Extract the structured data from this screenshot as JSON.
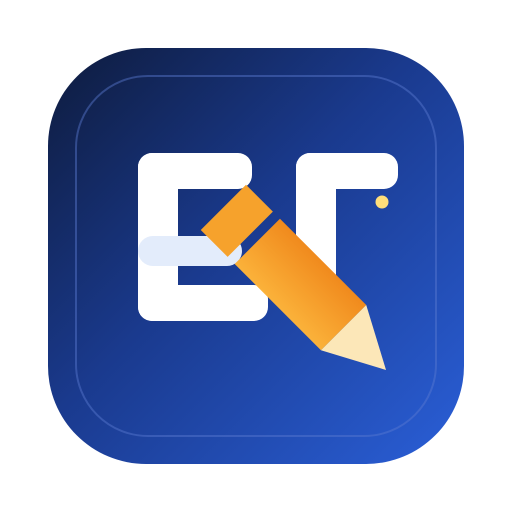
{
  "app_icon": {
    "name": "editor-app-icon",
    "glyph": "pencil-icon",
    "colors": {
      "background_start": "#0E1B3C",
      "background_mid": "#1A3A8E",
      "background_end": "#2A5FD8",
      "inner_border": "#5B7BD0",
      "letters": "#FFFFFF",
      "highlight_bar": "#E3ECFB",
      "pencil_body_light": "#FBB23A",
      "pencil_body_dark": "#F08A1D",
      "pencil_tip": "#FCE7B8",
      "sparkle_dot": "#FFDE7A"
    }
  }
}
